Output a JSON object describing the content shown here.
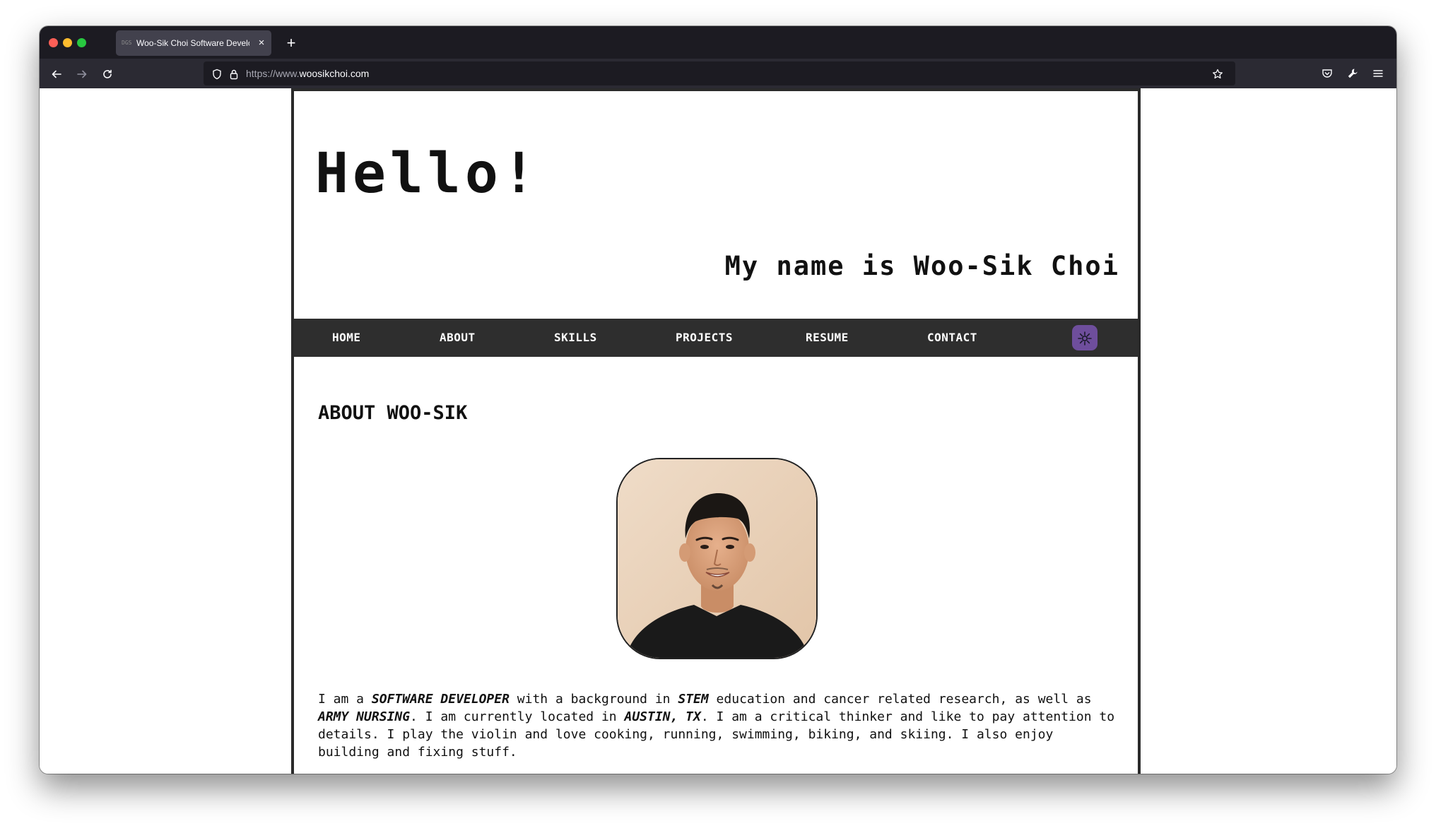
{
  "browser": {
    "tab": {
      "favicon_text": "DGS",
      "title": "Woo-Sik Choi Software Developer",
      "close": "×"
    },
    "new_tab": "+",
    "url_prefix": "https://www.",
    "url_host": "woosikchoi.com"
  },
  "header": {
    "hello": "Hello!",
    "subtitle": "My name is Woo-Sik Choi"
  },
  "nav": {
    "items": [
      "HOME",
      "ABOUT",
      "SKILLS",
      "PROJECTS",
      "RESUME",
      "CONTACT"
    ]
  },
  "about": {
    "heading": "ABOUT WOO-SIK",
    "bio": {
      "p1": "I am a ",
      "b1": "SOFTWARE DEVELOPER",
      "p2": " with a background in ",
      "b2": "STEM",
      "p3": " education and cancer related research, as well as ",
      "b3": "ARMY NURSING",
      "p4": ". I am currently located in ",
      "b4": "AUSTIN, TX",
      "p5": ". I am a critical thinker and like to pay attention to details. I play the violin and love cooking, running, swimming, biking, and skiing. I also enjoy building and fixing stuff."
    }
  },
  "colors": {
    "titlebar": "#1c1b22",
    "toolbar": "#2b2a33",
    "navbar": "#2e2e2e",
    "theme_toggle": "#6e4e9c"
  }
}
